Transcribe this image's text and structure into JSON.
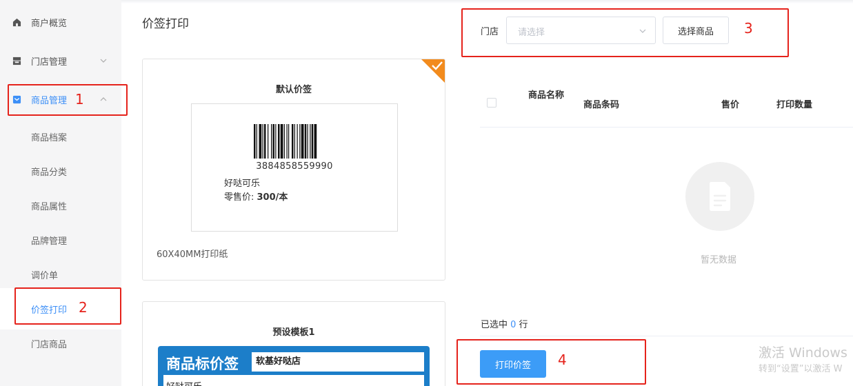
{
  "sidebar": {
    "items": [
      {
        "label": "商户概览",
        "icon": "home-icon"
      },
      {
        "label": "门店管理",
        "icon": "store-icon"
      },
      {
        "label": "商品管理",
        "icon": "product-icon"
      }
    ],
    "sub_items": [
      "商品档案",
      "商品分类",
      "商品属性",
      "品牌管理",
      "调价单",
      "价签打印",
      "门店商品"
    ]
  },
  "annotations": [
    "1",
    "2",
    "3",
    "4"
  ],
  "page": {
    "title": "价签打印"
  },
  "templates": [
    {
      "title": "默认价签",
      "barcode": "3884858559990",
      "product_name": "好哒可乐",
      "price_label": "零售价: ",
      "price_value": "300/本",
      "paper": "60X40MM打印纸"
    },
    {
      "title": "预设模板1",
      "header": "商品标价签",
      "store": "软基好哒店",
      "product_name": "好哒可乐"
    }
  ],
  "filter": {
    "store_label": "门店",
    "store_placeholder": "请选择",
    "select_button": "选择商品"
  },
  "table": {
    "columns": [
      "商品名称",
      "商品条码",
      "售价",
      "打印数量"
    ],
    "empty_text": "暂无数据"
  },
  "footer": {
    "selected_prefix": "已选中 ",
    "selected_count": "0",
    "selected_suffix": " 行",
    "print_button": "打印价签"
  },
  "watermark": {
    "line1": "激活 Windows",
    "line2": "转到“设置”以激活 W"
  },
  "colors": {
    "accent": "#3c8ff7",
    "annotation": "#e5221b",
    "corner": "#f28b1d",
    "template_blue": "#1c7ec9"
  }
}
